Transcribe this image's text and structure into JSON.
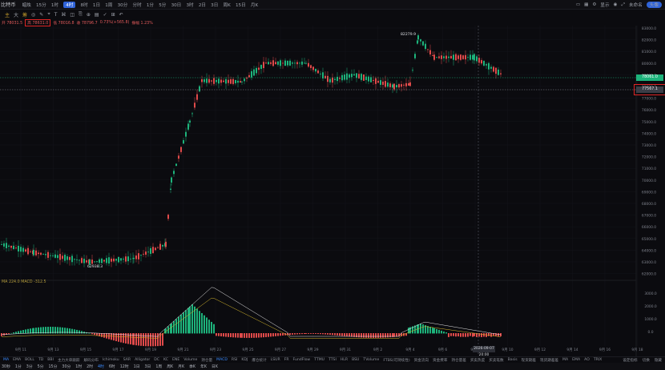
{
  "header": {
    "symbol_title": "比特币",
    "chart_type_label": "蜡烛",
    "timeframes": [
      "15分",
      "1时",
      "4时",
      "8时",
      "1日",
      "1周",
      "30分",
      "分时",
      "1分",
      "5分",
      "30日",
      "3时",
      "2日",
      "3日",
      "周K",
      "15日",
      "月K"
    ],
    "active_timeframe": "4时",
    "right_items": [
      "显示",
      "未命名",
      "头像"
    ],
    "account_label": "未命名"
  },
  "toolbar": {
    "items": [
      "主",
      "大",
      "筹",
      "◎",
      "✎",
      "⌖",
      "T",
      "⌘",
      "◫",
      "⎘",
      "⊕",
      "▤",
      "✓",
      "⊞",
      "↶"
    ]
  },
  "ohlc": {
    "open": "开 78031.5",
    "high": "高 78631.0",
    "low": "低 78016.8",
    "close": "收 78796.7",
    "change": "0.73%(+565.8)",
    "amp": "振幅 1.23%"
  },
  "price_labels": {
    "current": "78061.0",
    "cursor": "77567.1",
    "high_marker": "82279.9",
    "low_marker": "62938.3"
  },
  "y_axis": {
    "ticks": [
      "83000.0",
      "82000.0",
      "81000.0",
      "80000.0",
      "79000.0",
      "78000.0",
      "77000.0",
      "76000.0",
      "75000.0",
      "74000.0",
      "73000.0",
      "72000.0",
      "71000.0",
      "70000.0",
      "69000.0",
      "68000.0",
      "67000.0",
      "66000.0",
      "65000.0",
      "64000.0",
      "63000.0",
      "62000.0"
    ],
    "macd_ticks": [
      "3000.0",
      "2000.0",
      "1000.0",
      "0.0"
    ]
  },
  "x_axis": {
    "ticks": [
      "9月 11",
      "9月 13",
      "9月 15",
      "9月 17",
      "9月 19",
      "9月 21",
      "9月 23",
      "9月 25",
      "9月 27",
      "9月 29",
      "9月 31",
      "9月 2",
      "9月 4",
      "9月 6",
      "9月 8",
      "9月 10",
      "9月 12",
      "9月 14",
      "9月 16",
      "9月 18"
    ],
    "cursor_date": "2026-09-07 20:00"
  },
  "macd_label": "MA 224.0  MACD -312.5",
  "indicators": {
    "items": [
      "MA",
      "EMA",
      "BOLL",
      "TD",
      "BBI",
      "主力大单跟踪",
      "解码分布",
      "Ichimoku",
      "SAR",
      "Alligator",
      "DC",
      "KC",
      "ENE",
      "Volume",
      "持仓量",
      "MACD",
      "RSI",
      "KDJ",
      "爆仓统计",
      "LSUR",
      "FR",
      "FundFlow",
      "TTMU",
      "TTSI",
      "HLR",
      "BSU",
      "TVolume",
      "FTBS(可持续性)",
      "资金流向",
      "资金费率",
      "持仓量差",
      "买卖热度",
      "买卖笔数",
      "Basis",
      "现货期差",
      "现货期差差",
      "MA",
      "EMA",
      "AO",
      "TRIX"
    ],
    "right_items": [
      "设定指标",
      "切换",
      "隐藏"
    ],
    "active": [
      "MA",
      "MACD"
    ]
  },
  "bottombar": {
    "items": [
      "30秒",
      "1分",
      "3分",
      "5分",
      "15分",
      "30分",
      "1时",
      "2时",
      "4时",
      "6时",
      "12时",
      "1日",
      "3日",
      "1周",
      "周K",
      "月K",
      "季K",
      "年K",
      "日K"
    ],
    "active": "4时"
  },
  "colors": {
    "up": "#1db37b",
    "down": "#e04a4a",
    "background": "#0b0b0f",
    "accent": "#2f63d8"
  }
}
